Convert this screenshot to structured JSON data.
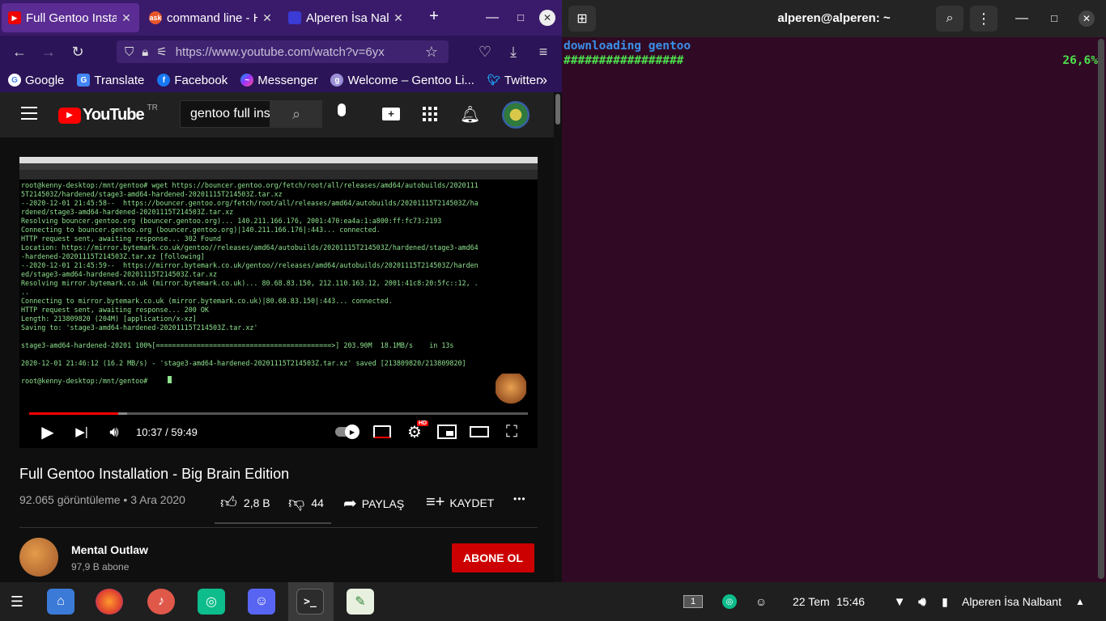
{
  "browser": {
    "tabs": [
      {
        "title": "Full Gentoo Installa",
        "favicon": "youtube-icon",
        "active": true
      },
      {
        "title": "command line - H",
        "favicon": "askubuntu-icon",
        "active": false
      },
      {
        "title": "Alperen İsa Nalba",
        "favicon": "page-icon",
        "active": false
      }
    ],
    "new_tab": "+",
    "url": "https://www.youtube.com/watch?v=6yx",
    "bookmarks": [
      "Google",
      "Translate",
      "Facebook",
      "Messenger",
      "Welcome – Gentoo Li...",
      "Twitter"
    ],
    "bookmarks_more": "»"
  },
  "youtube": {
    "logo_text": "YouTube",
    "region": "TR",
    "search_value": "gentoo full ins",
    "video": {
      "terminal_text": "root@kenny-desktop:/mnt/gentoo# wget https://bouncer.gentoo.org/fetch/root/all/releases/amd64/autobuilds/2020111\n5T214503Z/hardened/stage3-amd64-hardened-20201115T214503Z.tar.xz\n--2020-12-01 21:45:58--  https://bouncer.gentoo.org/fetch/root/all/releases/amd64/autobuilds/20201115T214503Z/ha\nrdened/stage3-amd64-hardened-20201115T214503Z.tar.xz\nResolving bouncer.gentoo.org (bouncer.gentoo.org)... 140.211.166.176, 2001:470:ea4a:1:a800:ff:fc73:2193\nConnecting to bouncer.gentoo.org (bouncer.gentoo.org)|140.211.166.176|:443... connected.\nHTTP request sent, awaiting response... 302 Found\nLocation: https://mirror.bytemark.co.uk/gentoo//releases/amd64/autobuilds/20201115T214503Z/hardened/stage3-amd64\n-hardened-20201115T214503Z.tar.xz [following]\n--2020-12-01 21:45:59--  https://mirror.bytemark.co.uk/gentoo//releases/amd64/autobuilds/20201115T214503Z/harden\ned/stage3-amd64-hardened-20201115T214503Z.tar.xz\nResolving mirror.bytemark.co.uk (mirror.bytemark.co.uk)... 80.68.83.150, 212.110.163.12, 2001:41c8:20:5fc::12, .\n..\nConnecting to mirror.bytemark.co.uk (mirror.bytemark.co.uk)|80.68.83.150|:443... connected.\nHTTP request sent, awaiting response... 200 OK\nLength: 213809820 (204M) [application/x-xz]\nSaving to: 'stage3-amd64-hardened-20201115T214503Z.tar.xz'\n\nstage3-amd64-hardened-20201 100%[===========================================>] 203.90M  18.1MB/s    in 13s\n\n2020-12-01 21:46:12 (16.2 MB/s) - 'stage3-amd64-hardened-20201115T214503Z.tar.xz' saved [213809820/213809820]\n\nroot@kenny-desktop:/mnt/gentoo# ",
      "time": "10:37 / 59:49",
      "progress": 0.178,
      "buffered": 0.197,
      "hd_badge": "HD"
    },
    "title": "Full Gentoo Installation - Big Brain Edition",
    "meta": "92.065 görüntüleme • 3 Ara 2020",
    "likes": "2,8 B",
    "dislikes": "44",
    "share": "PAYLAŞ",
    "save": "KAYDET",
    "more": "•••",
    "channel": {
      "name": "Mental Outlaw",
      "subs": "97,9 B abone"
    },
    "subscribe": "ABONE OL"
  },
  "terminal": {
    "title": "alperen@alperen: ~",
    "line1": "downloading gentoo",
    "line2": "#################",
    "percent": "26,6%"
  },
  "taskbar": {
    "workspace": "1",
    "date": "22 Tem",
    "time": "15:46",
    "user": "Alperen İsa Nalbant",
    "apps": [
      "files-icon",
      "firefox-icon",
      "music-icon",
      "element-icon",
      "discord-icon",
      "terminal-icon",
      "text-editor-icon"
    ]
  },
  "colors": {
    "tabbar": "#3a1b6b",
    "terminal_bg": "#300a24",
    "youtube_red": "#ff0000",
    "subscribe_red": "#cc0000"
  }
}
